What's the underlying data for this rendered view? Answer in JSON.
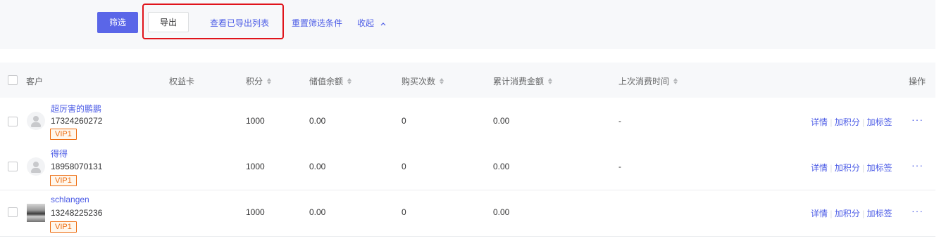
{
  "filters": {
    "filter_label": "筛选",
    "export_label": "导出",
    "view_exported_label": "查看已导出列表",
    "reset_label": "重置筛选条件",
    "collapse_label": "收起"
  },
  "table": {
    "headers": {
      "customer": "客户",
      "rights_card": "权益卡",
      "points": "积分",
      "balance": "储值余额",
      "purchase_count": "购买次数",
      "total_spent": "累计消费金额",
      "last_purchase": "上次消费时间",
      "actions": "操作"
    },
    "rows": [
      {
        "name": "超厉害的鹏鹏",
        "phone": "17324260272",
        "tag": "VIP1",
        "rights_card": "",
        "points": "1000",
        "balance": "0.00",
        "purchase_count": "0",
        "total_spent": "0.00",
        "last_purchase": "-",
        "avatar": "default-avatar-icon"
      },
      {
        "name": "得得",
        "phone": "18958070131",
        "tag": "VIP1",
        "rights_card": "",
        "points": "1000",
        "balance": "0.00",
        "purchase_count": "0",
        "total_spent": "0.00",
        "last_purchase": "-",
        "avatar": "default-avatar-icon"
      },
      {
        "name": "schlangen",
        "phone": "13248225236",
        "tag": "VIP1",
        "rights_card": "",
        "points": "1000",
        "balance": "0.00",
        "purchase_count": "0",
        "total_spent": "0.00",
        "last_purchase": "",
        "avatar": "photo-avatar"
      }
    ],
    "row_actions": {
      "detail": "详情",
      "add_points": "加积分",
      "add_tag": "加标签",
      "more": "···"
    }
  },
  "colors": {
    "primary": "#5a66e8",
    "link": "#4b5be6",
    "highlight": "#e0141b",
    "vip_tag": "#ed6a0c"
  }
}
